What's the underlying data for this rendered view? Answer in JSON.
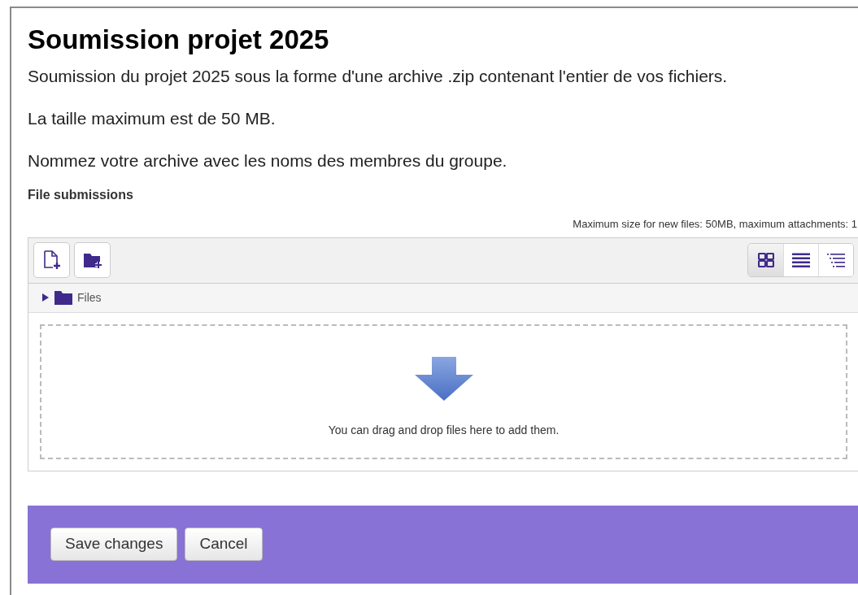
{
  "title": "Soumission projet 2025",
  "paragraphs": [
    "Soumission du projet 2025 sous la forme d'une archive .zip contenant l'entier de vos fichiers.",
    "La taille maximum est de 50 MB.",
    "Nommez votre archive avec les noms des membres du groupe."
  ],
  "section_label": "File submissions",
  "limits": "Maximum size for new files: 50MB, maximum attachments: 1",
  "view_modes": [
    {
      "kind": "icons",
      "selected": true
    },
    {
      "kind": "list",
      "selected": false
    },
    {
      "kind": "tree",
      "selected": false
    }
  ],
  "folder": {
    "name": "Files",
    "expanded": false
  },
  "drop_hint": "You can drag and drop files here to add them.",
  "buttons": [
    "Save changes",
    "Cancel"
  ]
}
